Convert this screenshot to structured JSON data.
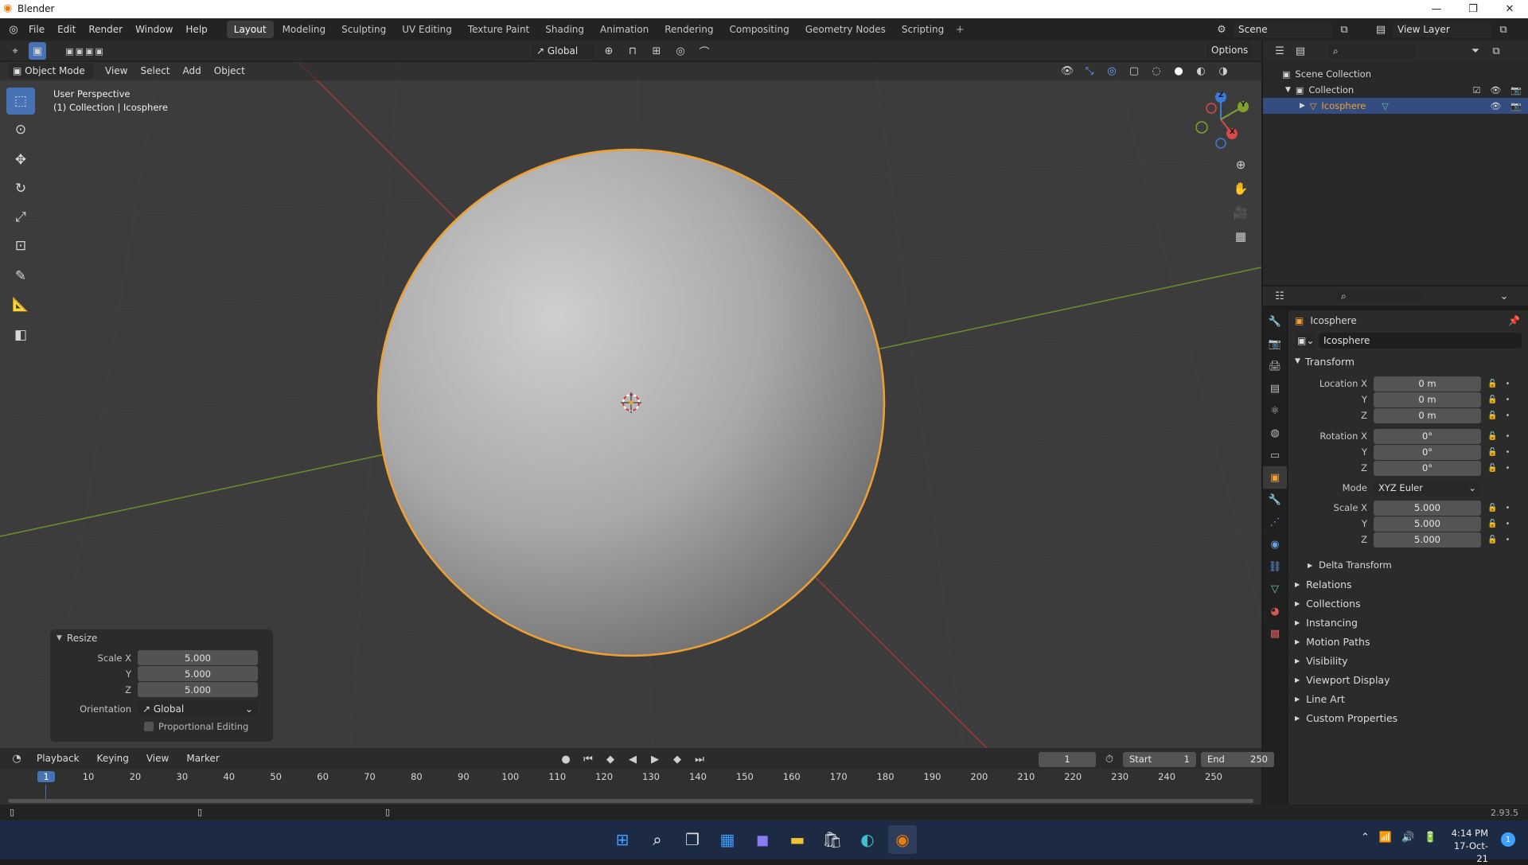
{
  "window": {
    "title": "Blender",
    "min": "—",
    "max": "❐",
    "close": "✕"
  },
  "menu": [
    "File",
    "Edit",
    "Render",
    "Window",
    "Help"
  ],
  "workspaces": [
    {
      "label": "Layout",
      "active": true
    },
    {
      "label": "Modeling"
    },
    {
      "label": "Sculpting"
    },
    {
      "label": "UV Editing"
    },
    {
      "label": "Texture Paint"
    },
    {
      "label": "Shading"
    },
    {
      "label": "Animation"
    },
    {
      "label": "Rendering"
    },
    {
      "label": "Compositing"
    },
    {
      "label": "Geometry Nodes"
    },
    {
      "label": "Scripting"
    }
  ],
  "scene": {
    "label": "Scene",
    "view_layer": "View Layer"
  },
  "viewport_header": {
    "mode": "Object Mode",
    "menus": [
      "View",
      "Select",
      "Add",
      "Object"
    ],
    "orientation": "Global",
    "options": "Options"
  },
  "viewport": {
    "perspective": "User Perspective",
    "collection_info": "(1) Collection | Icosphere",
    "accent": "#f0a030"
  },
  "gizmo": {
    "x": "X",
    "y": "Y",
    "z": "Z"
  },
  "resize_panel": {
    "title": "Resize",
    "scale_x_label": "Scale X",
    "scale_y_label": "Y",
    "scale_z_label": "Z",
    "scale_x": "5.000",
    "scale_y": "5.000",
    "scale_z": "5.000",
    "orientation_label": "Orientation",
    "orientation": "Global",
    "proportional": "Proportional Editing"
  },
  "outliner": {
    "scene_collection": "Scene Collection",
    "collection": "Collection",
    "object": "Icosphere"
  },
  "properties": {
    "object_name": "Icosphere",
    "data_name": "Icosphere",
    "transform": "Transform",
    "location": {
      "label": "Location X",
      "x": "0 m",
      "y": "0 m",
      "z": "0 m"
    },
    "rotation": {
      "label": "Rotation X",
      "x": "0°",
      "y": "0°",
      "z": "0°"
    },
    "mode_label": "Mode",
    "mode": "XYZ Euler",
    "scale": {
      "label": "Scale X",
      "x": "5.000",
      "y": "5.000",
      "z": "5.000"
    },
    "axis_y": "Y",
    "axis_z": "Z",
    "delta": "Delta Transform",
    "sections": [
      "Relations",
      "Collections",
      "Instancing",
      "Motion Paths",
      "Visibility",
      "Viewport Display",
      "Line Art",
      "Custom Properties"
    ]
  },
  "timeline": {
    "menus": [
      "Playback",
      "Keying",
      "View",
      "Marker"
    ],
    "current_frame": "1",
    "start_label": "Start",
    "start": "1",
    "end_label": "End",
    "end": "250",
    "ticks": [
      "1",
      "10",
      "20",
      "30",
      "40",
      "50",
      "60",
      "70",
      "80",
      "90",
      "100",
      "110",
      "120",
      "130",
      "140",
      "150",
      "160",
      "170",
      "180",
      "190",
      "200",
      "210",
      "220",
      "230",
      "240",
      "250"
    ]
  },
  "status": {
    "version": "2.93.5"
  },
  "taskbar": {
    "time": "4:14 PM",
    "date": "17-Oct-21",
    "notif": "1"
  }
}
